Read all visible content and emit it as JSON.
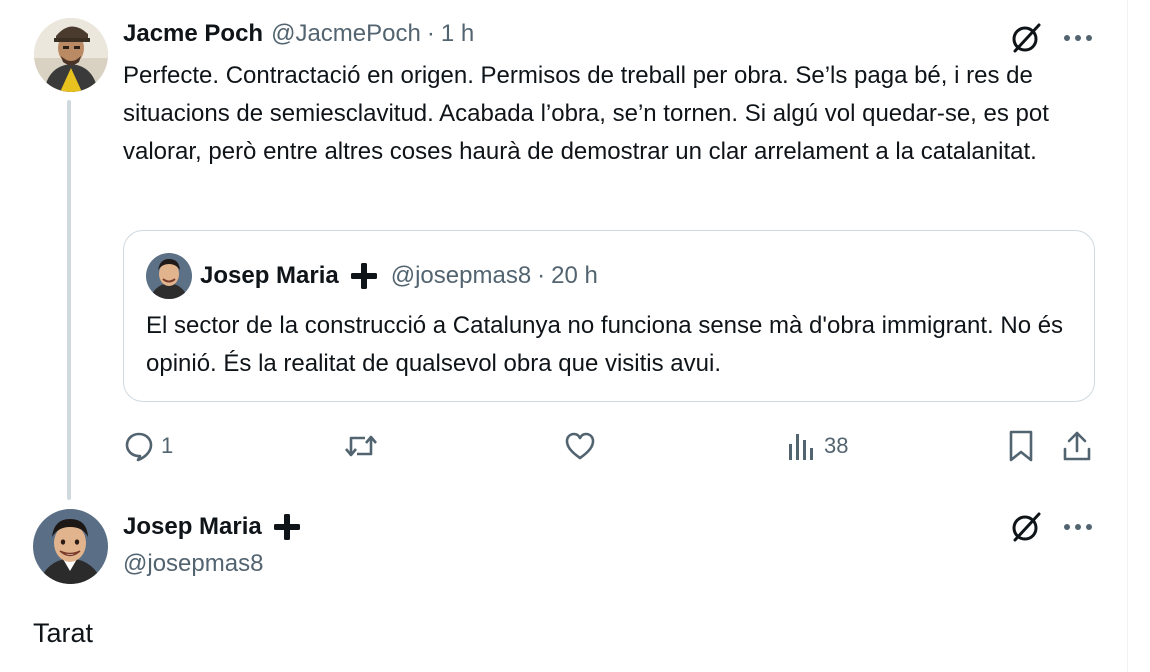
{
  "tweet": {
    "author_name": "Jacme Poch",
    "author_handle": "@JacmePoch",
    "separator": "·",
    "time": "1 h",
    "text": "Perfecte. Contractació en origen. Permisos de treball per obra. Se’ls paga bé, i res de situacions de semiesclavitud. Acabada l’obra, se’n tornen. Si algú vol quedar-se, es pot valorar, però entre altres coses haurà de demostrar un clar arrelament a la catalanitat.",
    "quote": {
      "author_name": "Josep Maria",
      "author_handle": "@josepmas8",
      "separator": "·",
      "time": "20 h",
      "text": "El sector de la construcció a Catalunya no funciona sense mà d'obra immigrant. No és opinió. És la realitat de qualsevol obra que visitis avui."
    },
    "actions": {
      "reply_count": "1",
      "retweet_count": "",
      "like_count": "",
      "views_count": "38"
    }
  },
  "reply": {
    "author_name": "Josep Maria",
    "author_handle": "@josepmas8",
    "text": "Tarat"
  },
  "icons": {
    "grok": "grok-icon",
    "more": "more-icon",
    "reply": "reply-icon",
    "retweet": "retweet-icon",
    "like": "like-icon",
    "views": "views-icon",
    "bookmark": "bookmark-icon",
    "share": "share-icon",
    "badge": "plus-badge-icon"
  },
  "colors": {
    "text": "#0f1419",
    "muted": "#536471",
    "border": "#cfd9de",
    "thread_line": "#cfd9de"
  }
}
